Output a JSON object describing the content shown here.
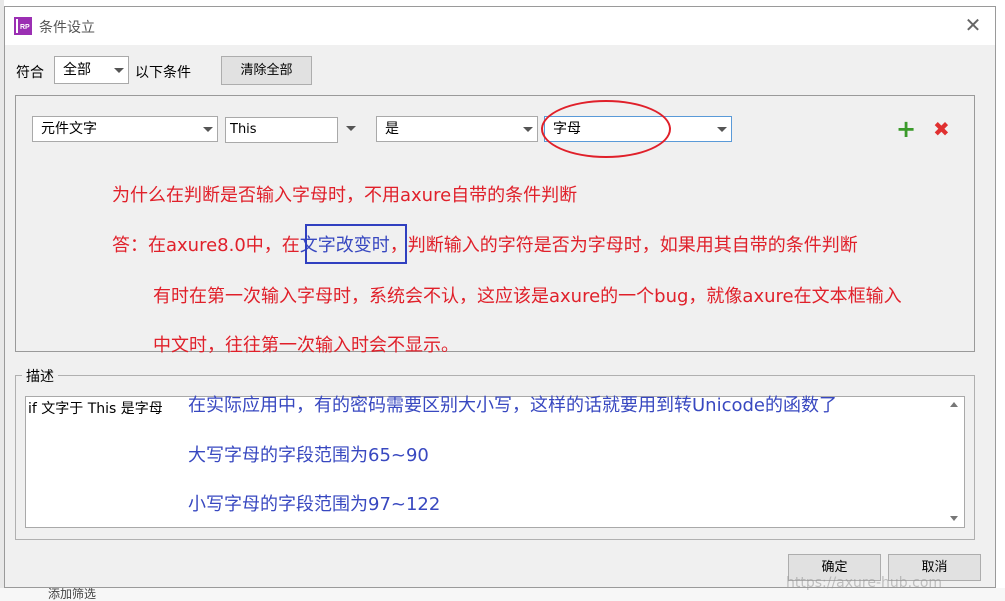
{
  "background": {
    "bottom_text": "添加筛选"
  },
  "dialog": {
    "title": "条件设立",
    "app_icon_text": "RP",
    "close_glyph": "✕",
    "match_label": "符合",
    "match_select": "全部",
    "match_suffix": "以下条件",
    "clear_all_button": "清除全部"
  },
  "condition_row": {
    "field1": "元件文字",
    "field2": "This",
    "operator": "是",
    "value": "字母",
    "add_glyph": "+",
    "remove_glyph": "✖"
  },
  "annotation_red": {
    "question": "为什么在判断是否输入字母时，不用axure自带的条件判断",
    "answer_prefix": "答：在axure8.0中，在",
    "answer_highlight": "文字改变时",
    "answer_suffix": "，判断输入的字符是否为字母时，如果用其自带的条件判断",
    "line2": "有时在第一次输入字母时，系统会不认，这应该是axure的一个bug，就像axure在文本框输入",
    "line3": "中文时，往往第一次输入时会不显示。"
  },
  "description": {
    "legend": "描述",
    "text": "if 文字于 This 是字母"
  },
  "annotation_blue": {
    "line1": "在实际应用中，有的密码需要区别大小写，这样的话就要用到转Unicode的函数了",
    "line2": "大写字母的字段范围为65~90",
    "line3": "小写字母的字段范围为97~122"
  },
  "footer": {
    "ok_button": "确定",
    "cancel_button": "取消"
  },
  "watermark": "https://axure-hub.com",
  "colors": {
    "annotation_red": "#e0202a",
    "annotation_blue": "#3848c0",
    "add_green": "#3a9a2a",
    "remove_red": "#e03030"
  }
}
